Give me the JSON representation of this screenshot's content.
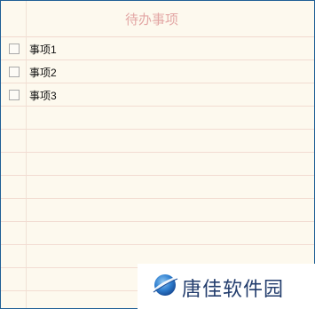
{
  "window": {
    "title": "待办事项",
    "accent_color": "#1f5f95",
    "paper_color": "#fdf9ee",
    "title_color": "#e3a7a5",
    "rule_color": "#f2dcd2"
  },
  "todo": {
    "items": [
      {
        "label": "事项1",
        "checked": false
      },
      {
        "label": "事项2",
        "checked": false
      },
      {
        "label": "事项3",
        "checked": false
      }
    ]
  },
  "watermark": {
    "text": "唐佳软件园",
    "icon": "planet-logo-icon"
  }
}
